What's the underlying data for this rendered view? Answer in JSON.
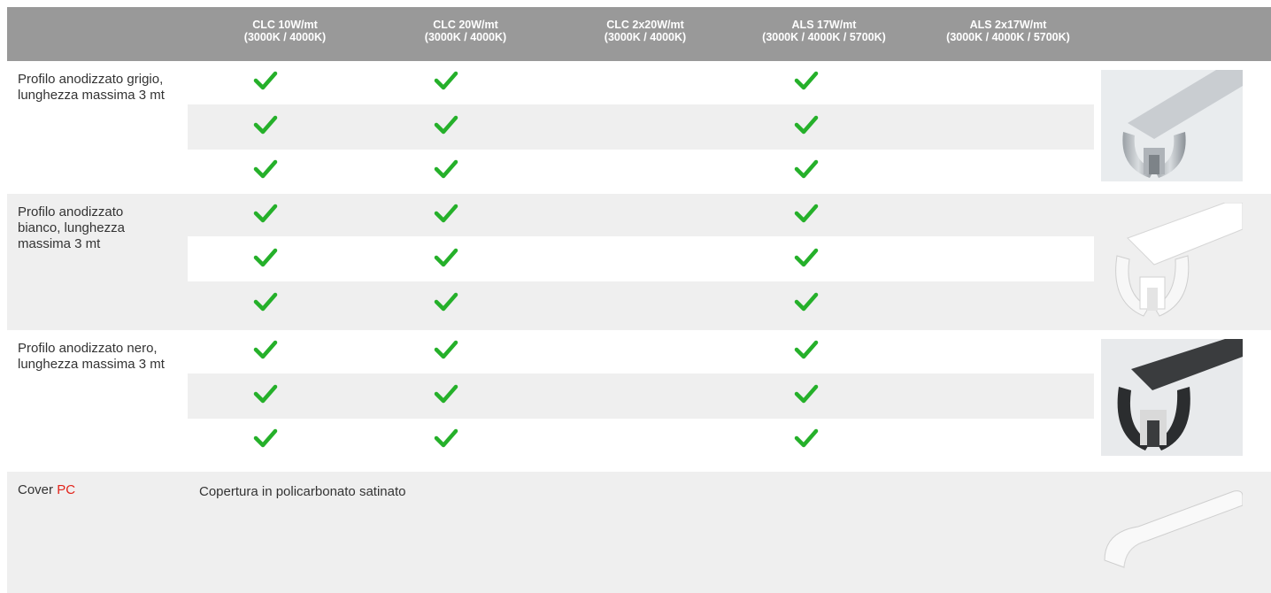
{
  "table": {
    "columns": [
      {
        "name": "CLC 10W/mt",
        "temps": "(3000K / 4000K)"
      },
      {
        "name": "CLC 20W/mt",
        "temps": "(3000K / 4000K)"
      },
      {
        "name": "CLC 2x20W/mt",
        "temps": "(3000K / 4000K)"
      },
      {
        "name": "ALS 17W/mt",
        "temps": "(3000K / 4000K / 5700K)"
      },
      {
        "name": "ALS 2x17W/mt",
        "temps": "(3000K / 4000K / 5700K)"
      }
    ],
    "rows": [
      {
        "label": "Profilo anodizzato grigio, lunghezza massima 3 mt",
        "image": "grey-profile-image",
        "checks": [
          true,
          true,
          false,
          true,
          false
        ]
      },
      {
        "label": "Profilo anodizzato bianco, lunghezza massima 3 mt",
        "image": "white-profile-image",
        "checks": [
          true,
          true,
          false,
          true,
          false
        ]
      },
      {
        "label": "Profilo anodizzato nero, lunghezza massima 3 mt",
        "image": "black-profile-image",
        "checks": [
          true,
          true,
          false,
          true,
          false
        ]
      }
    ],
    "cover": {
      "label_prefix": "Cover",
      "label_accent": "PC",
      "description": "Copertura in policarbonato satinato",
      "image": "cover-image"
    }
  },
  "colors": {
    "header_bg": "#999999",
    "header_text": "#ffffff",
    "row_grey": "#efefef",
    "check_green": "#25b02a",
    "accent_red": "#e2231a"
  },
  "icons": {
    "check": "check-icon"
  }
}
